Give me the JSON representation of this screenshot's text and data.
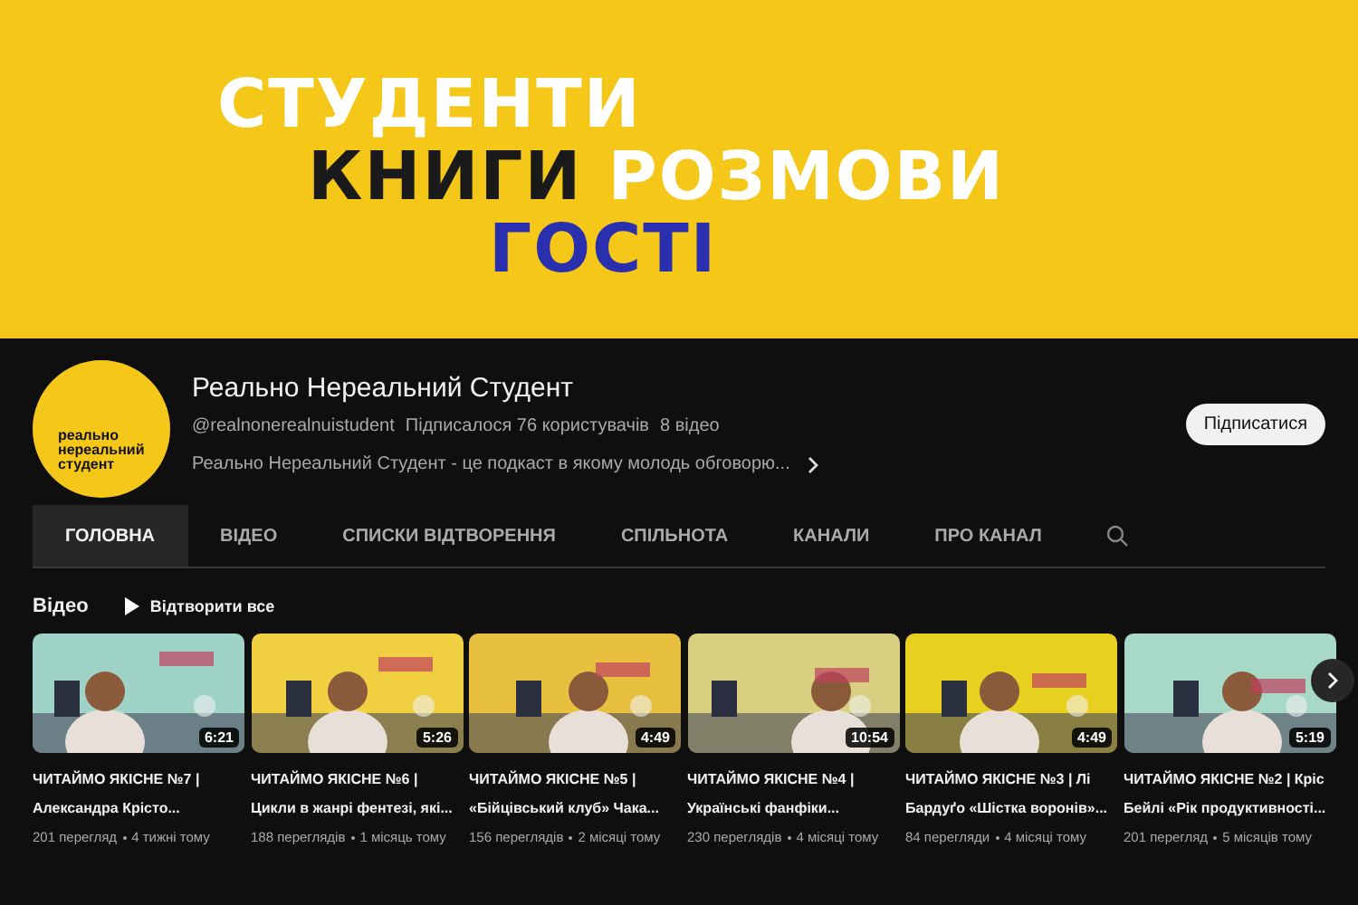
{
  "banner": {
    "lines": [
      {
        "text": "СТУДЕНТИ",
        "kind": "light"
      },
      {
        "text": "КНИГИ",
        "kind": "dark"
      },
      {
        "text": "РОЗМОВИ",
        "kind": "light"
      },
      {
        "text": "ГОСТІ",
        "kind": "accent"
      }
    ]
  },
  "channel": {
    "avatar_text": "реально нереальний студент",
    "name": "Реально Нереальний Студент",
    "handle": "@realnonerealnuistudent",
    "subscribers": "Підписалося 76 користувачів",
    "videos_count": "8 відео",
    "description": "Реально Нереальний Студент - це подкаст в якому молодь обговорю...",
    "subscribe_button": "Підписатися"
  },
  "tabs": [
    {
      "label": "ГОЛОВНА",
      "selected": true
    },
    {
      "label": "ВІДЕО",
      "selected": false
    },
    {
      "label": "СПИСКИ ВІДТВОРЕННЯ",
      "selected": false
    },
    {
      "label": "СПІЛЬНОТА",
      "selected": false
    },
    {
      "label": "КАНАЛИ",
      "selected": false
    },
    {
      "label": "ПРО КАНАЛ",
      "selected": false
    }
  ],
  "section": {
    "title": "Відео",
    "play_all": "Відтворити все"
  },
  "videos": [
    {
      "title": "ЧИТАЙМО ЯКІСНЕ №7 | Александра Крісто...",
      "duration": "6:21",
      "views": "201 перегляд",
      "age": "4 тижні тому"
    },
    {
      "title": "ЧИТАЙМО ЯКІСНЕ №6 | Цикли в жанрі фентезі, які...",
      "duration": "5:26",
      "views": "188 переглядів",
      "age": "1 місяць тому"
    },
    {
      "title": "ЧИТАЙМО ЯКІСНЕ №5 | «Бійцівський клуб» Чака...",
      "duration": "4:49",
      "views": "156 переглядів",
      "age": "2 місяці тому"
    },
    {
      "title": "ЧИТАЙМО ЯКІСНЕ №4 | Українські фанфіки...",
      "duration": "10:54",
      "views": "230 переглядів",
      "age": "4 місяці тому"
    },
    {
      "title": "ЧИТАЙМО ЯКІСНЕ №3 | Лі Бардуґо «Шістка воронів»...",
      "duration": "4:49",
      "views": "84 перегляди",
      "age": "4 місяці тому"
    },
    {
      "title": "ЧИТАЙМО ЯКІСНЕ №2 | Кріс Бейлі «Рік продуктивності...",
      "duration": "5:19",
      "views": "201 перегляд",
      "age": "5 місяців тому"
    }
  ]
}
